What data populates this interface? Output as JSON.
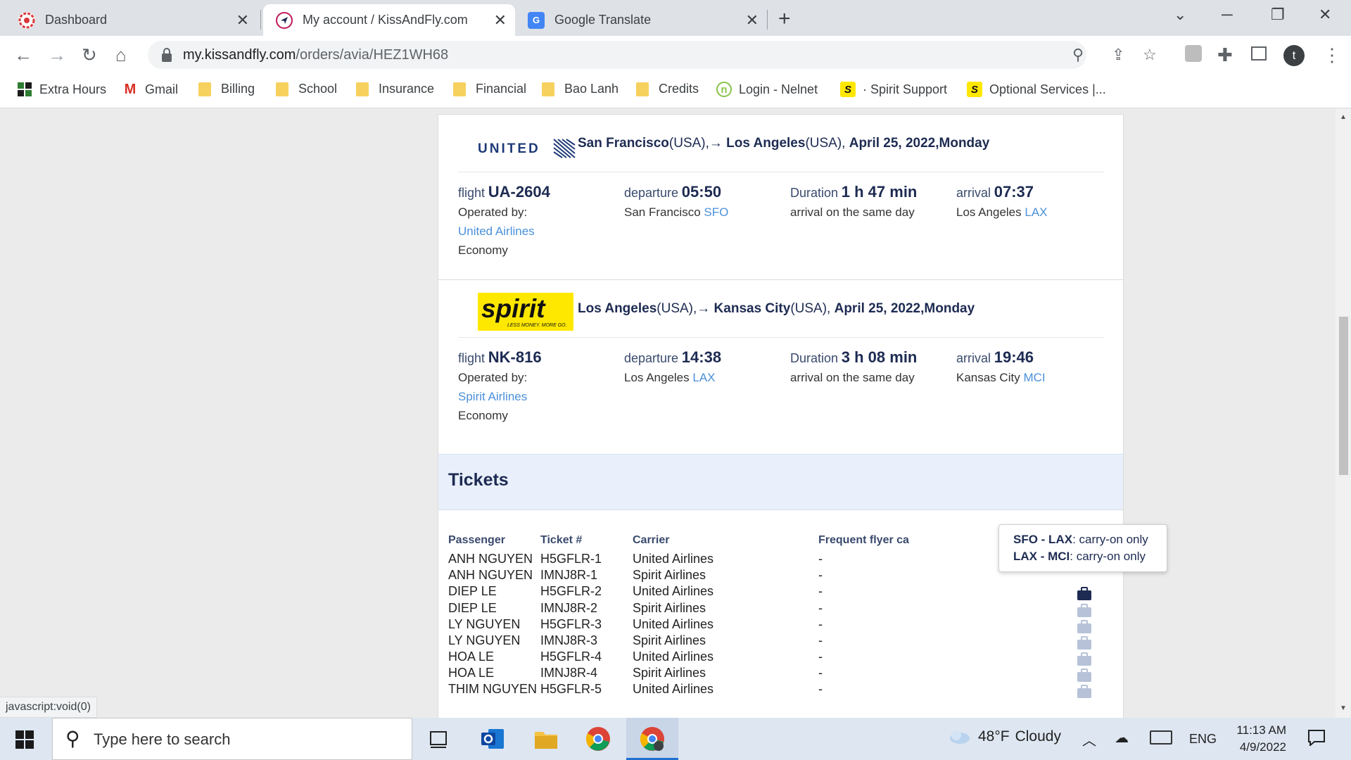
{
  "browser": {
    "tabs": [
      {
        "title": "Dashboard",
        "close": "✕"
      },
      {
        "title": "My account / KissAndFly.com",
        "close": "✕"
      },
      {
        "title": "Google Translate",
        "close": "✕"
      }
    ],
    "new_tab": "+",
    "url_host": "my.kissandfly.com",
    "url_path": "/orders/avia/HEZ1WH68",
    "profile_initial": "t",
    "bookmarks": [
      {
        "label": "Extra Hours",
        "icon": "extra-hours-icon"
      },
      {
        "label": "Gmail",
        "icon": "gmail-icon"
      },
      {
        "label": "Billing",
        "icon": "folder-icon"
      },
      {
        "label": "School",
        "icon": "folder-icon"
      },
      {
        "label": "Insurance",
        "icon": "folder-icon"
      },
      {
        "label": "Financial",
        "icon": "folder-icon"
      },
      {
        "label": "Bao Lanh",
        "icon": "folder-icon"
      },
      {
        "label": "Credits",
        "icon": "folder-icon"
      },
      {
        "label": "Login - Nelnet",
        "icon": "nelnet-icon"
      },
      {
        "label": "· Spirit Support",
        "icon": "spirit-icon"
      },
      {
        "label": "Optional Services |...",
        "icon": "spirit-icon"
      }
    ]
  },
  "segments": [
    {
      "airline_logo": "UNITED",
      "from_city": "San Francisco",
      "from_country": "(USA),",
      "arrow": "→",
      "to_city": "Los Angeles",
      "to_country": "(USA),",
      "date": "April 25, 2022,Monday",
      "flight_label": "flight",
      "flight_no": "UA-2604",
      "operated_by": "Operated by:",
      "operator": "United Airlines",
      "cabin": "Economy",
      "departure_label": "departure",
      "departure_time": "05:50",
      "departure_city": "San Francisco",
      "departure_code": "SFO",
      "duration_label": "Duration",
      "duration": "1 h 47 min",
      "arrival_note": "arrival on the same day",
      "arrival_label": "arrival",
      "arrival_time": "07:37",
      "arrival_city": "Los Angeles",
      "arrival_code": "LAX"
    },
    {
      "airline_logo": "spirit",
      "logo_tagline": "LESS MONEY. MORE GO.",
      "from_city": "Los Angeles",
      "from_country": "(USA),",
      "arrow": "→",
      "to_city": "Kansas City",
      "to_country": "(USA),",
      "date": "April 25, 2022,Monday",
      "flight_label": "flight",
      "flight_no": "NK-816",
      "operated_by": "Operated by:",
      "operator": "Spirit Airlines",
      "cabin": "Economy",
      "departure_label": "departure",
      "departure_time": "14:38",
      "departure_city": "Los Angeles",
      "departure_code": "LAX",
      "duration_label": "Duration",
      "duration": "3 h 08 min",
      "arrival_note": "arrival on the same day",
      "arrival_label": "arrival",
      "arrival_time": "19:46",
      "arrival_city": "Kansas City",
      "arrival_code": "MCI"
    }
  ],
  "tickets": {
    "title": "Tickets",
    "headers": [
      "Passenger",
      "Ticket #",
      "Carrier",
      "Frequent flyer ca"
    ],
    "rows": [
      {
        "passenger": "ANH NGUYEN",
        "ticket": "H5GFLR-1",
        "carrier": "United Airlines",
        "ff": "-"
      },
      {
        "passenger": "ANH NGUYEN",
        "ticket": "IMNJ8R-1",
        "carrier": "Spirit Airlines",
        "ff": "-"
      },
      {
        "passenger": "DIEP LE",
        "ticket": "H5GFLR-2",
        "carrier": "United Airlines",
        "ff": "-"
      },
      {
        "passenger": "DIEP LE",
        "ticket": "IMNJ8R-2",
        "carrier": "Spirit Airlines",
        "ff": "-"
      },
      {
        "passenger": "LY NGUYEN",
        "ticket": "H5GFLR-3",
        "carrier": "United Airlines",
        "ff": "-"
      },
      {
        "passenger": "LY NGUYEN",
        "ticket": "IMNJ8R-3",
        "carrier": "Spirit Airlines",
        "ff": "-"
      },
      {
        "passenger": "HOA LE",
        "ticket": "H5GFLR-4",
        "carrier": "United Airlines",
        "ff": "-"
      },
      {
        "passenger": "HOA LE",
        "ticket": "IMNJ8R-4",
        "carrier": "Spirit Airlines",
        "ff": "-"
      },
      {
        "passenger": "THIM NGUYEN",
        "ticket": "H5GFLR-5",
        "carrier": "United Airlines",
        "ff": "-"
      }
    ],
    "tooltip": [
      {
        "route": "SFO - LAX",
        "text": ": carry-on only"
      },
      {
        "route": "LAX - MCI",
        "text": ": carry-on only"
      }
    ]
  },
  "status_bar": "javascript:void(0)",
  "taskbar": {
    "search_placeholder": "Type here to search",
    "weather_temp": "48°F",
    "weather_text": "Cloudy",
    "language": "ENG",
    "time": "11:13 AM",
    "date": "4/9/2022"
  },
  "colors": {
    "navy": "#1d2b52",
    "link": "#4a90d9",
    "spirit_yellow": "#ffe800",
    "tickets_band": "#e9f0fb"
  }
}
